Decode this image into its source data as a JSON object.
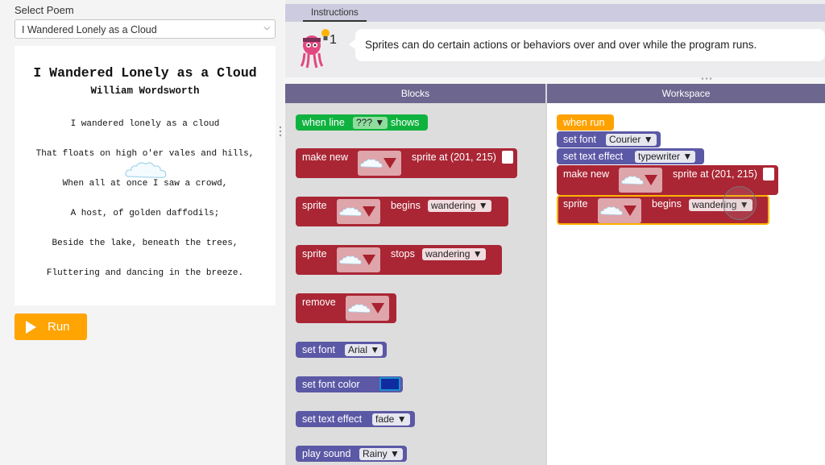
{
  "left_panel": {
    "select_label": "Select Poem",
    "poem_select_value": "I Wandered Lonely as a Cloud",
    "run_label": "Run"
  },
  "poem": {
    "title": "I Wandered Lonely as a Cloud",
    "author": "William Wordsworth",
    "lines": [
      "I wandered lonely as a cloud",
      "That floats on high o'er vales and hills,",
      "When all at once I saw a crowd,",
      "A host, of golden daffodils;",
      "Beside the lake, beneath the trees,",
      "Fluttering and dancing in the breeze."
    ]
  },
  "instructions": {
    "tab_label": "Instructions",
    "hint_count": "1",
    "text": "Sprites can do certain actions or behaviors over and over while the program runs."
  },
  "headers": {
    "blocks": "Blocks",
    "workspace": "Workspace"
  },
  "toolbox": {
    "when_line": {
      "prefix": "when line",
      "dropdown": "???",
      "suffix": "shows"
    },
    "make_new": {
      "prefix": "make new",
      "suffix": "sprite at (201, 215)"
    },
    "sprite_begins": {
      "prefix": "sprite",
      "middle": "begins",
      "dropdown": "wandering"
    },
    "sprite_stops": {
      "prefix": "sprite",
      "middle": "stops",
      "dropdown": "wandering"
    },
    "remove": {
      "prefix": "remove"
    },
    "set_font": {
      "prefix": "set font",
      "dropdown": "Arial"
    },
    "set_font_color": {
      "prefix": "set font color"
    },
    "set_text_effect": {
      "prefix": "set text effect",
      "dropdown": "fade"
    },
    "play_sound": {
      "prefix": "play sound",
      "dropdown": "Rainy"
    }
  },
  "workspace": {
    "when_run": "when run",
    "set_font": {
      "prefix": "set font",
      "dropdown": "Courier"
    },
    "set_text_effect": {
      "prefix": "set text effect",
      "dropdown": "typewriter"
    },
    "make_new": {
      "prefix": "make new",
      "suffix": "sprite at (201, 215)"
    },
    "sprite_begins": {
      "prefix": "sprite",
      "middle": "begins",
      "dropdown": "wandering"
    }
  },
  "colors": {
    "run_button": "#ffa400",
    "event_green": "#10b23f",
    "sprite_red": "#aa2635",
    "text_purple": "#5b58a6",
    "when_run_orange": "#ffa200",
    "header_purple": "#6d678f",
    "font_color_swatch": "#102aa0"
  },
  "icons": [
    "chevron-down-icon",
    "play-icon",
    "lightbulb-icon",
    "cloud-sprite-icon",
    "location-pin-icon",
    "drag-handle-icon"
  ]
}
